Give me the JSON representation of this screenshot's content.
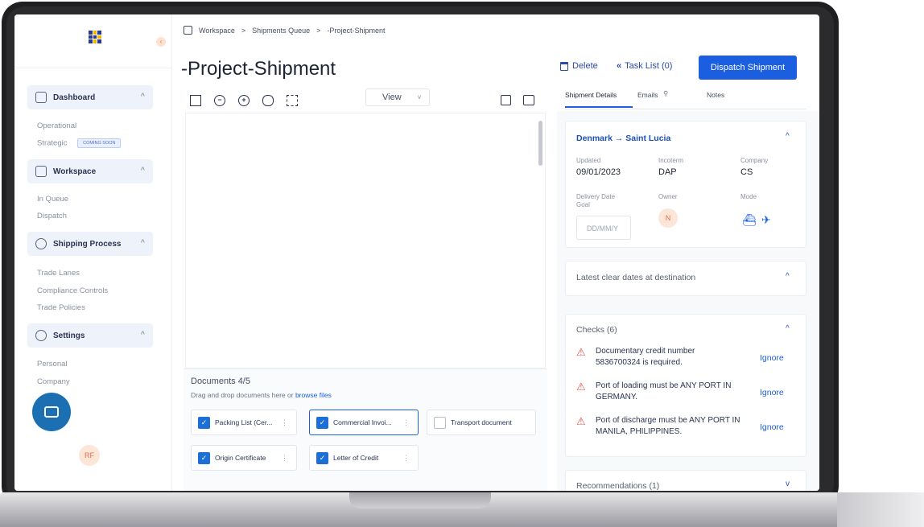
{
  "breadcrumb": {
    "items": [
      "Workspace",
      "Shipments Queue",
      "-Project-Shipment"
    ],
    "sep": ">"
  },
  "page": {
    "title": "-Project-Shipment"
  },
  "actions": {
    "delete": "Delete",
    "task_list": "Task List (0)",
    "task_list_glyph": "«",
    "dispatch": "Dispatch Shipment"
  },
  "sidebar": {
    "sections": [
      {
        "label": "Dashboard",
        "items": [
          "Operational",
          "Strategic"
        ]
      },
      {
        "label": "Workspace",
        "items": [
          "In Queue",
          "Dispatch"
        ]
      },
      {
        "label": "Shipping Process",
        "items": [
          "Trade Lanes",
          "Compliance Controls",
          "Trade Policies"
        ]
      },
      {
        "label": "Settings",
        "items": [
          "Personal",
          "Company"
        ]
      }
    ],
    "coming_soon": "COMING SOON",
    "user_initials": "RF"
  },
  "viewer": {
    "view_label": "View"
  },
  "documents": {
    "title": "Documents 4/5",
    "hint": "Drag and drop documents here or",
    "hint_link": "browse files",
    "items": [
      {
        "label": "Packing List (Cer...",
        "checked": true
      },
      {
        "label": "Commercial Invoi...",
        "checked": true
      },
      {
        "label": "Transport document",
        "checked": false
      },
      {
        "label": "Origin Certificate",
        "checked": true
      },
      {
        "label": "Letter of Credit",
        "checked": true
      }
    ]
  },
  "tabs": [
    "Shipment Details",
    "Emails",
    "Notes"
  ],
  "shipment": {
    "route": "Denmark → Saint Lucia",
    "updated_label": "Updated",
    "updated": "09/01/2023",
    "incoterm_label": "Incoterm",
    "incoterm": "DAP",
    "company_label": "Company",
    "company": "CS",
    "delivery_label_1": "Delivery Date",
    "delivery_label_2": "Goal",
    "delivery_placeholder": "DD/MM/Y",
    "owner_label": "Owner",
    "owner_initial": "N",
    "mode_label": "Mode"
  },
  "clear_dates": {
    "title": "Latest clear dates at destination"
  },
  "checks": {
    "title": "Checks (6)",
    "ignore": "Ignore",
    "items": [
      {
        "line1": "Documentary credit number",
        "line2": "5836700324 is required."
      },
      {
        "line1": "Port of loading must be ANY PORT IN",
        "line2": "GERMANY."
      },
      {
        "line1": "Port of discharge must be ANY PORT IN",
        "line2": "MANILA, PHILIPPINES."
      }
    ]
  },
  "recommendations": {
    "title": "Recommendations (1)"
  },
  "colors": {
    "primary": "#1b5fe0",
    "warning": "#e05050",
    "frame": "#1f1f22"
  }
}
